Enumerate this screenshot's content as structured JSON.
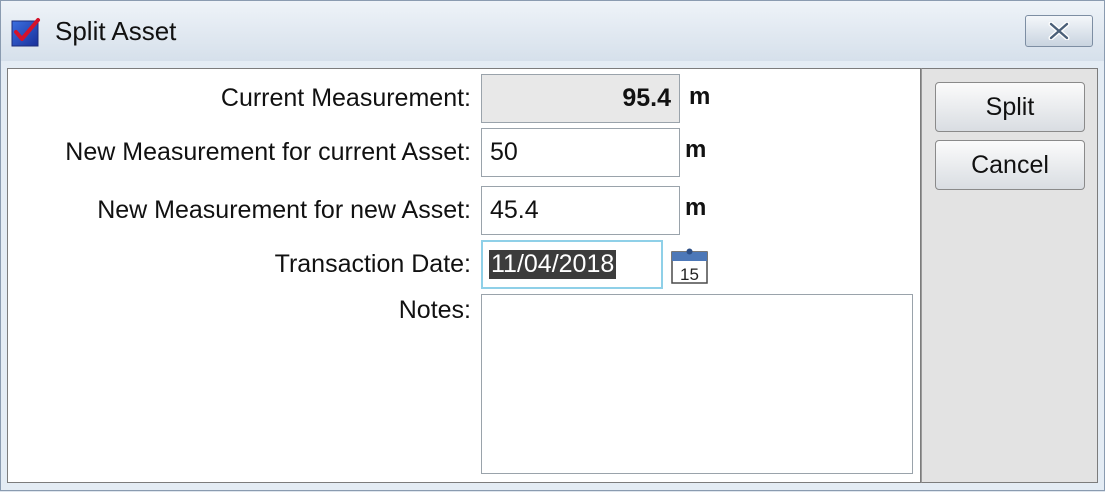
{
  "window": {
    "title": "Split Asset",
    "icon": "checkmark-app-icon",
    "close_icon": "close-x-icon"
  },
  "form": {
    "current_measurement": {
      "label": "Current Measurement:",
      "value": "95.4",
      "unit": "m"
    },
    "new_current_asset": {
      "label": "New Measurement for current Asset:",
      "value": "50",
      "unit": "m"
    },
    "new_asset": {
      "label": "New Measurement for new Asset:",
      "value": "45.4",
      "unit": "m"
    },
    "transaction_date": {
      "label": "Transaction Date:",
      "value": "11/04/2018",
      "calendar_day": "15"
    },
    "notes": {
      "label": "Notes:",
      "value": ""
    }
  },
  "buttons": {
    "split": "Split",
    "cancel": "Cancel"
  },
  "colors": {
    "titlebar": "#dfe7f0",
    "readonly_bg": "#e8e8e8",
    "selection_bg": "#3c3c3c",
    "side_panel": "#e3e3e3"
  }
}
